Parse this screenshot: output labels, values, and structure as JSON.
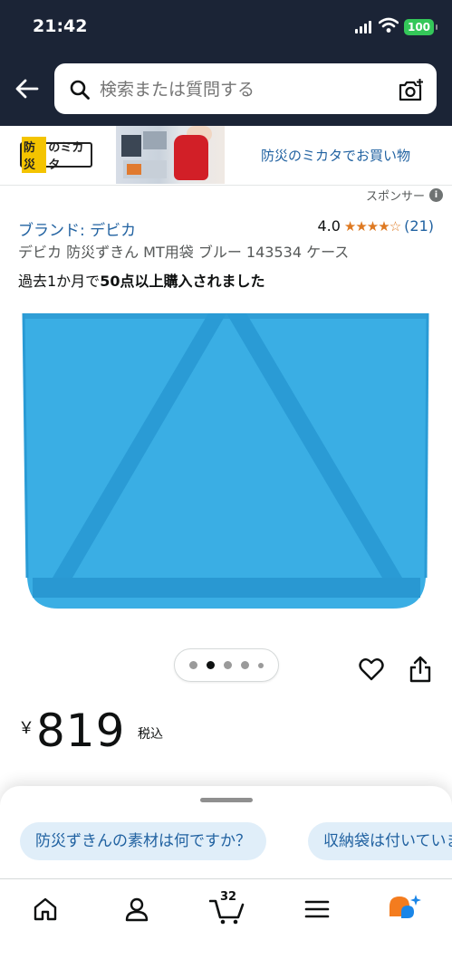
{
  "status_bar": {
    "time": "21:42",
    "battery": "100"
  },
  "search": {
    "placeholder": "検索または質問する"
  },
  "banner": {
    "logo_highlight": "防災",
    "logo_rest": "のミカタ",
    "text": "防災のミカタでお買い物"
  },
  "sponsor": {
    "label": "スポンサー"
  },
  "product": {
    "brand": "ブランド: デビカ",
    "rating": "4.0",
    "rating_stars": 4,
    "rating_count": "(21)",
    "title": "デビカ 防災ずきん MT用袋 ブルー 143534 ケース",
    "purchases_prefix": "過去1か月で",
    "purchases_bold": "50点以上購入されました",
    "image_color": "#3aaee4",
    "carousel_total": 5,
    "carousel_active": 2
  },
  "price": {
    "currency": "￥",
    "amount": "819",
    "tax_label": "税込"
  },
  "questions": [
    "防災ずきんの素材は何ですか？",
    "収納袋は付いていますか？"
  ],
  "tabbar": {
    "cart_count": "32",
    "items": [
      "home-icon",
      "account-icon",
      "cart-icon",
      "menu-icon",
      "rufus-icon"
    ]
  },
  "colors": {
    "header_bg": "#1b2436",
    "link": "#2162a1",
    "star": "#de7921",
    "chip_bg": "#e0eef9"
  }
}
